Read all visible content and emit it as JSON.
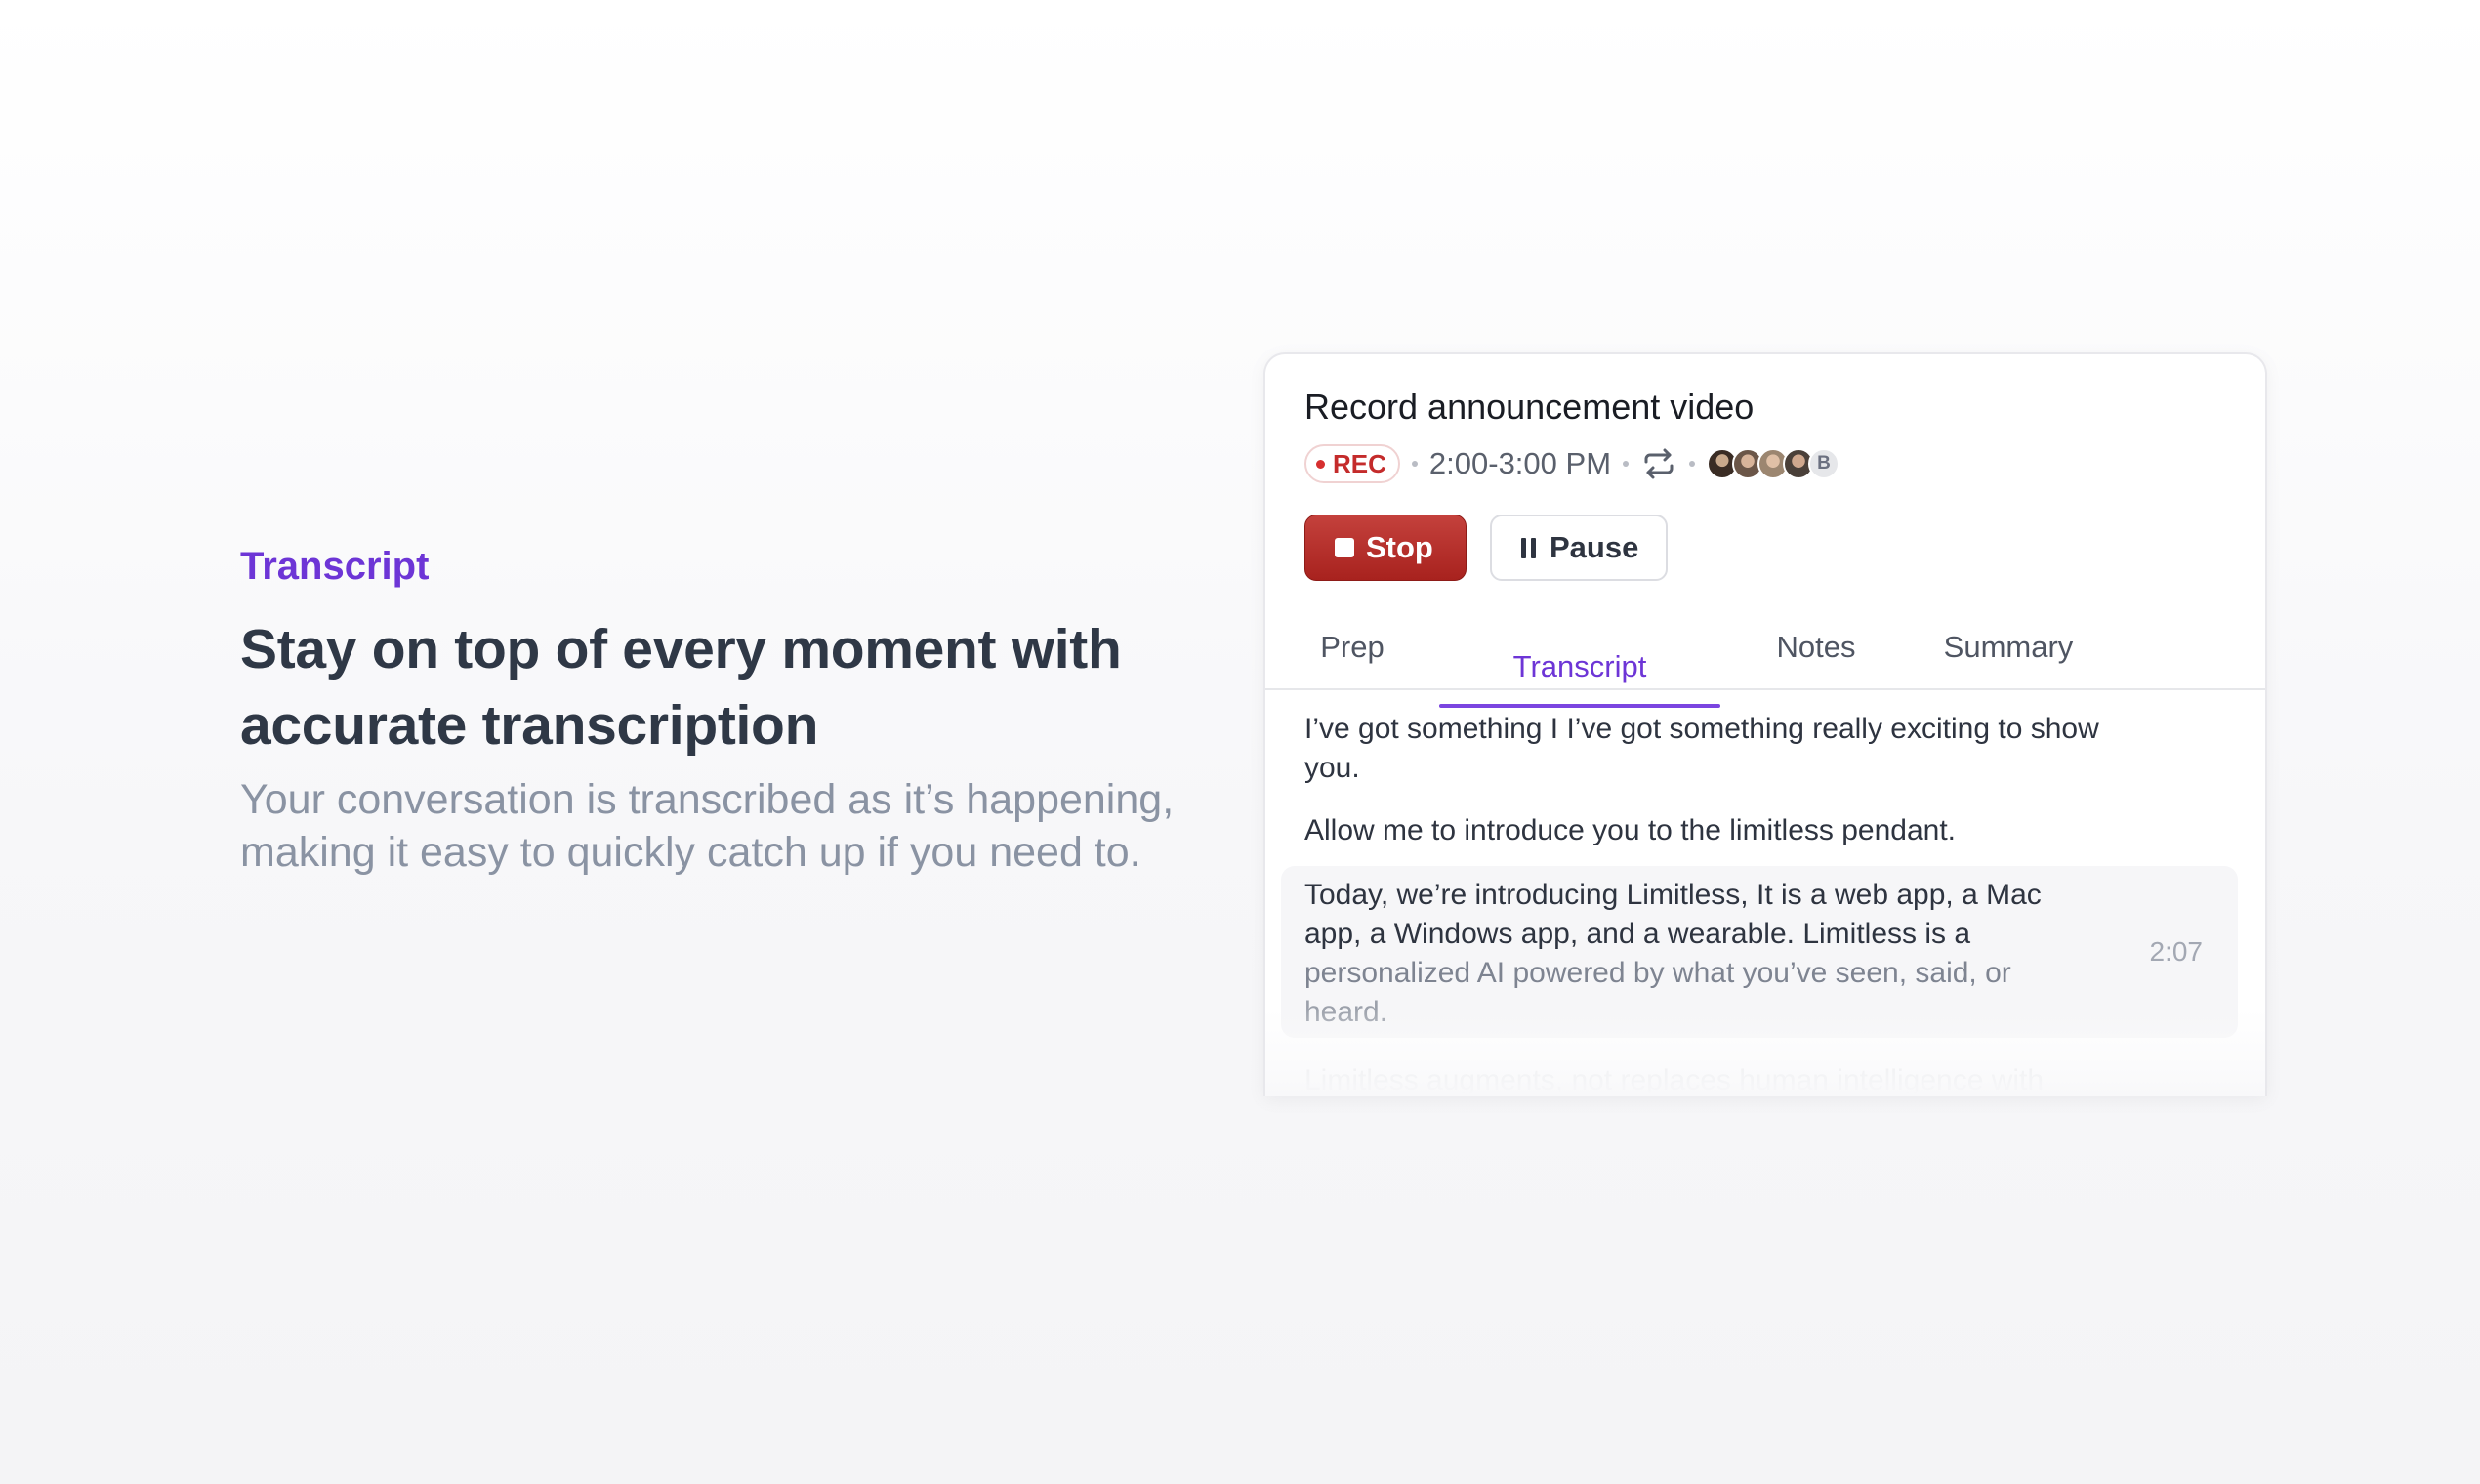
{
  "marketing": {
    "eyebrow": "Transcript",
    "headline_line1": "Stay on top of every moment with",
    "headline_line2": "accurate transcription",
    "subhead_line1": "Your conversation is transcribed as it’s happening,",
    "subhead_line2": "making it easy to quickly catch up if you need to."
  },
  "card": {
    "title": "Record announcement video",
    "rec_label": "REC",
    "time_range": "2:00-3:00 PM",
    "avatar_overflow_letter": "B",
    "stop_label": "Stop",
    "pause_label": "Pause",
    "tabs": [
      {
        "label": "Prep",
        "active": false
      },
      {
        "label": "Transcript",
        "active": true
      },
      {
        "label": "Notes",
        "active": false
      },
      {
        "label": "Summary",
        "active": false
      }
    ],
    "segments": [
      {
        "text": "I’ve got something I I’ve got something really exciting to show you."
      },
      {
        "text": "Allow me to introduce you to the limitless pendant."
      },
      {
        "line_a": "Today, we’re introducing Limitless, It is a web app, a Mac app, a Windows app, and a wearable. Limitless is a",
        "line_b": "personalized AI powered by what you’ve seen, said, or",
        "line_c": "heard.",
        "timestamp": "2:07"
      },
      {
        "text": "Limitless augments, not replaces human intelligence with"
      }
    ]
  },
  "colors": {
    "accent_purple": "#6d35d6",
    "rec_red": "#c42b2b",
    "stop_button": "#b42e2a"
  },
  "icons": {
    "repeat": "repeat-icon",
    "stop": "stop-square-icon",
    "pause": "pause-icon",
    "rec_dot": "record-dot-icon"
  }
}
